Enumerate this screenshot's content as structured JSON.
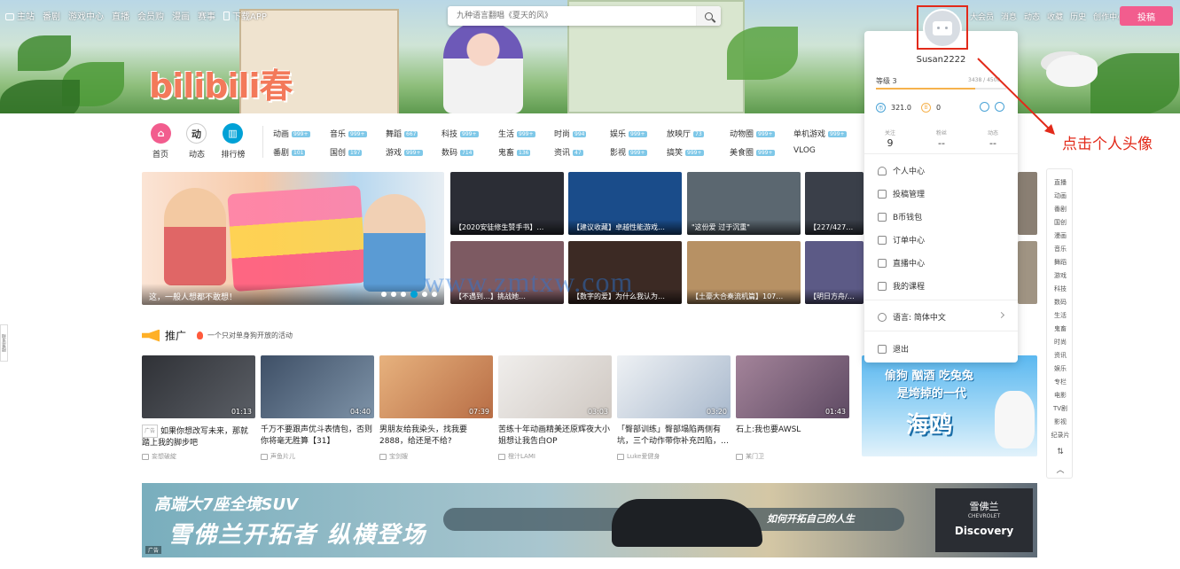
{
  "top_nav": {
    "items": [
      "主站",
      "番剧",
      "游戏中心",
      "直播",
      "会员购",
      "漫画",
      "赛事",
      "下载APP"
    ],
    "right_items": [
      "大会员",
      "消息",
      "动态",
      "收藏",
      "历史",
      "创作中心"
    ],
    "upload_label": "投稿"
  },
  "search": {
    "placeholder": "九种语言翻唱《夏天的风》"
  },
  "banner": {
    "logo_text": "bilibili春"
  },
  "quick_icons": [
    {
      "label": "首页",
      "color": "#f25d8e"
    },
    {
      "label": "动态",
      "color": "#ffffff"
    },
    {
      "label": "排行榜",
      "color": "#00a1d6"
    }
  ],
  "categories": [
    {
      "name": "动画",
      "count": "999+"
    },
    {
      "name": "音乐",
      "count": "999+"
    },
    {
      "name": "舞蹈",
      "count": "667"
    },
    {
      "name": "科技",
      "count": "999+"
    },
    {
      "name": "生活",
      "count": "999+"
    },
    {
      "name": "时尚",
      "count": "994"
    },
    {
      "name": "娱乐",
      "count": "999+"
    },
    {
      "name": "放映厅",
      "count": "73"
    },
    {
      "name": "动物圈",
      "count": "999+"
    },
    {
      "name": "单机游戏",
      "count": "999+"
    },
    {
      "name": "番剧",
      "count": "101"
    },
    {
      "name": "国创",
      "count": "197"
    },
    {
      "name": "游戏",
      "count": "999+"
    },
    {
      "name": "数码",
      "count": "714"
    },
    {
      "name": "鬼畜",
      "count": "136"
    },
    {
      "name": "资讯",
      "count": "47"
    },
    {
      "name": "影视",
      "count": "999+"
    },
    {
      "name": "搞笑",
      "count": "999+"
    },
    {
      "name": "美食圈",
      "count": "999+"
    },
    {
      "name": "VLOG",
      "count": ""
    }
  ],
  "carousel": {
    "caption": "这，一般人想都不敢想！",
    "dot_count": 6,
    "active_dot": 4
  },
  "thumbs": [
    {
      "caption": "【2020安徒修生赞手书】…",
      "bg": "#2b2d35"
    },
    {
      "caption": "【建议收藏】卓越性能游戏…",
      "bg": "#1a4c8a"
    },
    {
      "caption": "\"这份爱 过于沉重\"",
      "bg": "#5b6770"
    },
    {
      "caption": "【227/427大团…",
      "bg": "#3a3f49"
    },
    {
      "caption": "【不遇到…】挑战她…",
      "bg": "#7d5a62"
    },
    {
      "caption": "【数字的爱】为什么我认为…",
      "bg": "#3c2a24"
    },
    {
      "caption": "【土豪大合奏流机篇】107…",
      "bg": "#b79164"
    },
    {
      "caption": "【明日方舟/一周…",
      "bg": "#5c5a86"
    }
  ],
  "promo": {
    "title": "推广",
    "subtitle": "一个只对单身狗开放的活动"
  },
  "videos": [
    {
      "title": "如果你想改写未来，那就踏上我的脚步吧",
      "ad": "广告",
      "up": "妄想破綻",
      "duration": "01:13",
      "bg": "#3d3f44"
    },
    {
      "title": "千万不要跟声优斗表情包，否则你将毫无胜算【31】",
      "ad": "",
      "up": "声鱼片儿",
      "duration": "04:40",
      "bg": "#5a6a7c"
    },
    {
      "title": "男朋友给我染头，找我要2888，给还是不给?",
      "ad": "",
      "up": "宝剑嫂",
      "duration": "07:39",
      "bg": "#d79b6a"
    },
    {
      "title": "苦练十年动画精美还原辉夜大小姐想让我告白OP",
      "ad": "",
      "up": "橙汁LAMI",
      "duration": "03:03",
      "bg": "#e7e3df"
    },
    {
      "title": "「臀部训练」臀部塌陷两侧有坑，三个动作带你补充凹陷，…",
      "ad": "",
      "up": "Luke爱健身",
      "duration": "03:20",
      "bg": "#d9dde2"
    },
    {
      "title": "石上:我也要AWSL",
      "ad": "",
      "up": "某门卫",
      "duration": "01:43",
      "bg": "#8a6e7c"
    }
  ],
  "side_ad": {
    "line1": "偷狗 酗酒 吃兔兔",
    "line2": "是垮掉的一代",
    "line3": "海鸥"
  },
  "bottom_ad": {
    "line1": "高端大7座全境SUV",
    "line2": "雪佛兰开拓者 纵横登场",
    "slogan": "如何开拓自己的人生",
    "brand_cn": "雪佛兰",
    "brand_en": "CHEVROLET",
    "brand_model": "Discovery",
    "label": "广告"
  },
  "right_rail": [
    "直播",
    "动画",
    "番剧",
    "国创",
    "漫画",
    "音乐",
    "舞蹈",
    "游戏",
    "科技",
    "数码",
    "生活",
    "鬼畜",
    "时尚",
    "资讯",
    "娱乐",
    "专栏",
    "电影",
    "TV剧",
    "影视",
    "纪录片"
  ],
  "profile": {
    "username": "Susan2222",
    "level": "等级 3",
    "exp": "3438 / 4500",
    "exp_progress": 0.76,
    "coins": "321.0",
    "bcoin": "0",
    "follow_label": "关注",
    "follow_value": "9",
    "fans_label": "粉丝",
    "fans_value": "--",
    "dynamic_label": "动态",
    "dynamic_value": "--",
    "menu": [
      "个人中心",
      "投稿管理",
      "B币钱包",
      "订单中心",
      "直播中心",
      "我的课程"
    ],
    "language": "语言: 简体中文",
    "logout": "退出"
  },
  "annotation": {
    "text": "点击个人头像",
    "color": "#e22a1a"
  },
  "watermark": "www.zmtxw.com",
  "left_tab": "联系客服"
}
